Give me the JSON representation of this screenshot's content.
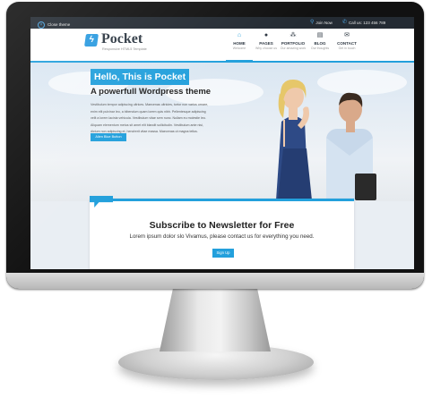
{
  "topbar": {
    "close_label": "Close theme",
    "item1": "Join Now",
    "item2": "Call us: 123 456 789"
  },
  "logo": {
    "name": "Pocket",
    "tagline": "Responsive HTML5 Template"
  },
  "nav": [
    {
      "label": "HOME",
      "sub": "Welcome",
      "icon": "home-icon"
    },
    {
      "label": "PAGES",
      "sub": "Why choose us",
      "icon": "user-icon"
    },
    {
      "label": "PORTFOLIO",
      "sub": "Our amazing work",
      "icon": "people-icon"
    },
    {
      "label": "BLOG",
      "sub": "Our thoughts",
      "icon": "book-icon"
    },
    {
      "label": "CONTACT",
      "sub": "Get in touch",
      "icon": "envelope-icon"
    }
  ],
  "hero": {
    "title": "Hello, This is Pocket",
    "subtitle": "A powerfull Wordpress theme",
    "paragraph": "Vestibulum tempor adipiscing ultrices. Maecenas ultricies, tortor non varius ornare, enim elit pulvinar leo, a bibendum quam lorem quis nibh. Pellentesque adipiscing velit a lorem lacinia vehicula. Vestibulum vitae sem nunc. Nullam eu molestie leo. Aliquam elementum metus sit amet elit blandit sollicitudin. Vestibulum ante nisi, dictum non adipiscing et, hendrerit vitae massa. Maecenas ut magna tellus.",
    "button": "Alien Blue Button"
  },
  "newsletter": {
    "title": "Subscribe to Newsletter for Free",
    "text": "Lorem ipsum dolor slo Vivamus, please contact us for everything you need.",
    "button": "Sign Up"
  },
  "colors": {
    "accent": "#23a0dc",
    "topbar": "#242b33",
    "bezel": "#111111"
  }
}
